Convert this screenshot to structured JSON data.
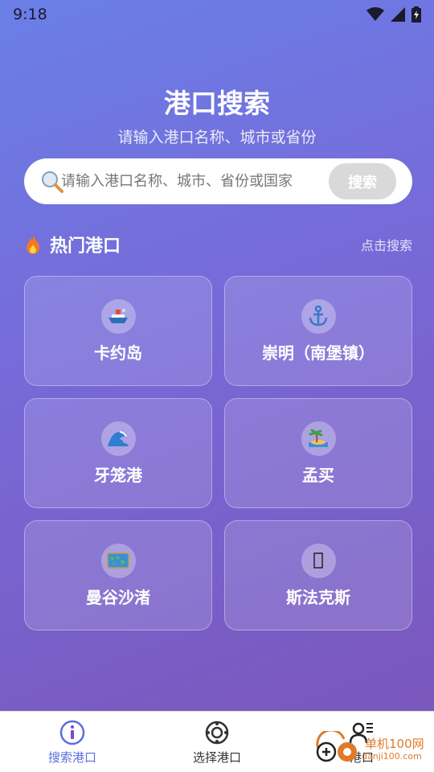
{
  "status_bar": {
    "time": "9:18"
  },
  "header": {
    "title": "港口搜索",
    "subtitle": "请输入港口名称、城市或省份"
  },
  "search": {
    "placeholder": "请输入港口名称、城市、省份或国家",
    "button_label": "搜索"
  },
  "hot": {
    "title": "热门港口",
    "link": "点击搜索",
    "ports": [
      {
        "label": "卡约岛",
        "icon": "ship-icon"
      },
      {
        "label": "崇明（南堡镇）",
        "icon": "anchor-icon"
      },
      {
        "label": "牙笼港",
        "icon": "wave-icon"
      },
      {
        "label": "孟买",
        "icon": "island-icon"
      },
      {
        "label": "曼谷沙渚",
        "icon": "world-map-icon"
      },
      {
        "label": "斯法克斯",
        "icon": "missing-glyph-icon"
      }
    ]
  },
  "nav": {
    "items": [
      {
        "label": "搜索港口",
        "active": true
      },
      {
        "label": "选择港口",
        "active": false
      },
      {
        "label": "港口",
        "active": false
      }
    ]
  },
  "watermark": {
    "text": "单机100网",
    "sub": "danji100.com"
  },
  "colors": {
    "accent": "#5b6ee0",
    "watermark": "#e07a2a"
  }
}
